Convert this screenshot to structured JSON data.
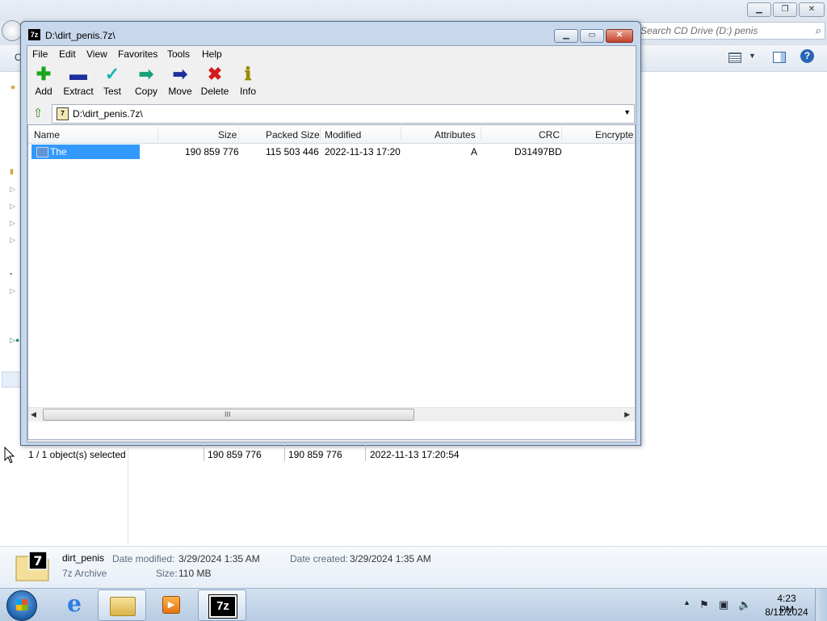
{
  "explorer": {
    "search_placeholder": "Search CD Drive (D:) penis",
    "cmd_left": "O",
    "details": {
      "name": "dirt_penis",
      "type": "7z Archive",
      "date_modified_label": "Date modified:",
      "date_modified": "3/29/2024 1:35 AM",
      "date_created_label": "Date created:",
      "date_created": "3/29/2024 1:35 AM",
      "size_label": "Size:",
      "size": "110 MB"
    }
  },
  "zip": {
    "title": "D:\\dirt_penis.7z\\",
    "title_icon": "7z",
    "menu": [
      "File",
      "Edit",
      "View",
      "Favorites",
      "Tools",
      "Help"
    ],
    "toolbar": [
      {
        "label": "Add",
        "icon": "plus-icon",
        "glyph": "✚",
        "color": "#1aa51a"
      },
      {
        "label": "Extract",
        "icon": "minus-icon",
        "glyph": "▬",
        "color": "#1c2f9e"
      },
      {
        "label": "Test",
        "icon": "check-icon",
        "glyph": "✓",
        "color": "#19b6b6"
      },
      {
        "label": "Copy",
        "icon": "copy-arrow-icon",
        "glyph": "➡",
        "color": "#17a07a"
      },
      {
        "label": "Move",
        "icon": "move-arrow-icon",
        "glyph": "➡",
        "color": "#1c2f9e"
      },
      {
        "label": "Delete",
        "icon": "delete-x-icon",
        "glyph": "✖",
        "color": "#d21a1a"
      },
      {
        "label": "Info",
        "icon": "info-icon",
        "glyph": "ℹ",
        "color": "#9a8a00"
      }
    ],
    "path": "D:\\dirt_penis.7z\\",
    "columns": [
      "Name",
      "Size",
      "Packed Size",
      "Modified",
      "Attributes",
      "CRC",
      "Encrypte"
    ],
    "rows": [
      {
        "name": "The Bakageddon.exe",
        "size": "190 859 776",
        "packed": "115 503 446",
        "modified": "2022-11-13 17:20",
        "attributes": "A",
        "crc": "D31497BD"
      }
    ],
    "status": {
      "selection": "1 / 1 object(s) selected",
      "size": "190 859 776",
      "packed": "190 859 776",
      "modified": "2022-11-13 17:20:54"
    },
    "scroll_grip": "III"
  },
  "taskbar": {
    "zip_label": "7z",
    "time": "4:23 PM",
    "date": "8/12/2024"
  }
}
